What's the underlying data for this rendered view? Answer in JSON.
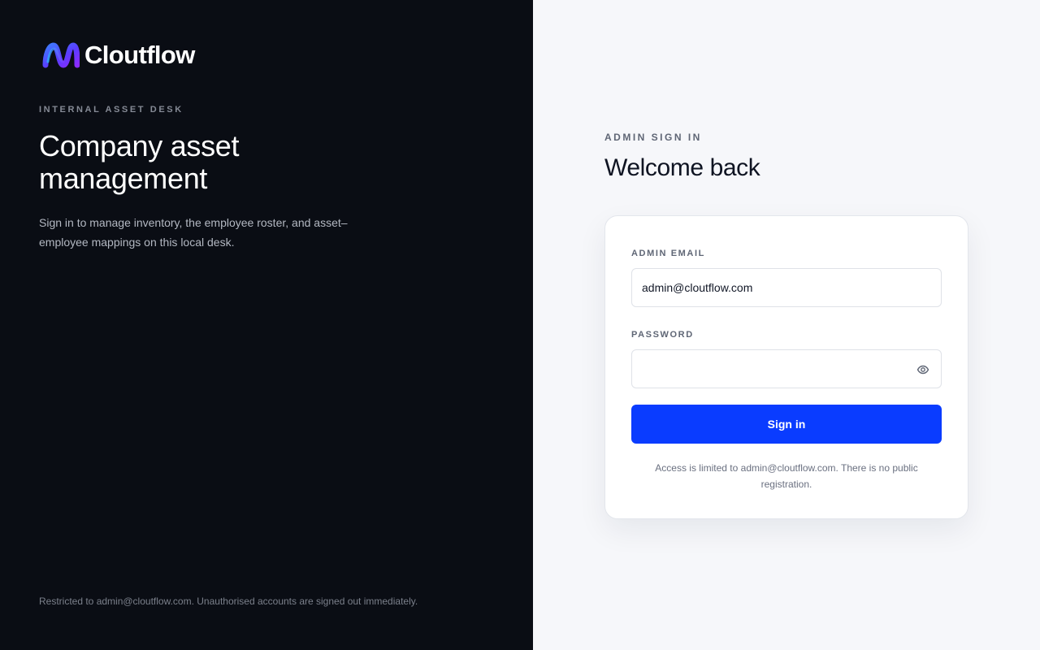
{
  "brand": {
    "name": "Cloutflow",
    "logo_icon": "cloutflow-logo-mark"
  },
  "hero": {
    "eyebrow": "INTERNAL ASSET DESK",
    "title": "Company asset management",
    "description": "Sign in to manage inventory, the employee roster, and asset–employee mappings on this local desk.",
    "footer": "Restricted to admin@cloutflow.com. Unauthorised accounts are signed out immediately."
  },
  "signin": {
    "eyebrow": "ADMIN SIGN IN",
    "heading": "Welcome back",
    "email_label": "ADMIN EMAIL",
    "email_value": "admin@cloutflow.com",
    "password_label": "PASSWORD",
    "password_value": "",
    "show_password_icon": "eye-icon",
    "submit_label": "Sign in",
    "note": "Access is limited to admin@cloutflow.com. There is no public registration."
  },
  "colors": {
    "left_background": "#0a0d14",
    "right_background": "#f6f7fa",
    "primary_button": "#0a3cff",
    "heading_text": "#0f1422"
  }
}
